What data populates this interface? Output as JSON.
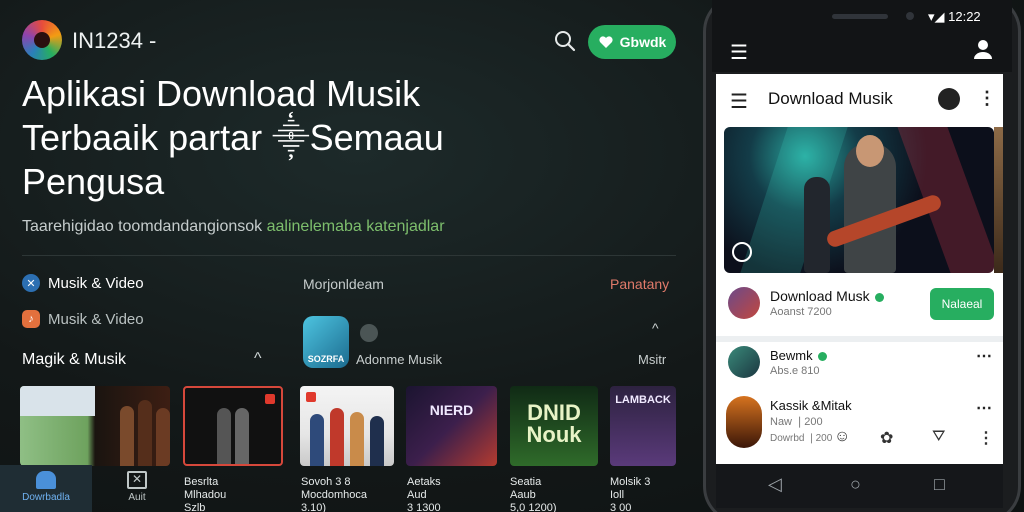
{
  "header": {
    "brand": "IN1234 -",
    "download_label": "Gbwdk"
  },
  "hero": {
    "title": "Aplikasi Download Musik Terbaaik partar ⸎Semaau Pengusa",
    "subtitle_a": "Taarehigidao toomdandangionsok ",
    "subtitle_b": "aalinelemaba katenjadlar"
  },
  "sidebar": {
    "items": [
      {
        "label": "Musik & Video",
        "icon": "globe-icon"
      },
      {
        "label": "Musik & Video",
        "icon": "app-icon"
      }
    ],
    "section_title": "Magik & Musik",
    "section_chevron": "^"
  },
  "middle": {
    "heading": "Morjonldeam",
    "right_label": "Panatany",
    "album_badge": "SOZRFA",
    "tag_label": "Adonme Musik",
    "side_label": "Msitr",
    "chevron": "^"
  },
  "thumbnails": [
    {
      "name": "field-band",
      "text": ""
    },
    {
      "name": "dark-duo",
      "text": ""
    },
    {
      "name": "band-portrait",
      "text": ""
    },
    {
      "name": "neon-guitar",
      "text": "NIERD"
    },
    {
      "name": "dnid-nouk",
      "text": "DNID\nNouk"
    },
    {
      "name": "purple-band",
      "text": "LAMBACK"
    }
  ],
  "captions": [
    {
      "line1": "Besrlta",
      "line2": "Mlhadou",
      "line3": "Szlb"
    },
    {
      "line1": "Sovoh 3 8",
      "line2": "Mocdomhoca",
      "line3": "3.10)"
    },
    {
      "line1": "Aetaks",
      "line2": "Aud",
      "line3": "3 1300"
    },
    {
      "line1": "Seatia",
      "line2": "Aaub",
      "line3": "5,0 1200)"
    },
    {
      "line1": "Molsik 3",
      "line2": "Ioll",
      "line3": "3 00"
    }
  ],
  "bottom_nav": [
    {
      "label": "Dowrbadla",
      "icon": "home-icon",
      "active": true
    },
    {
      "label": "Auit",
      "icon": "library-icon",
      "active": false
    }
  ],
  "phone": {
    "status": "▾◢ 12:22",
    "screen_title": "Download Musik",
    "row1": {
      "title": "Download Musk",
      "sub": "Aoanst 7200",
      "button": "Nalaeal"
    },
    "row2": {
      "title": "Bewmk",
      "sub": "Abs.e 810"
    },
    "row3": {
      "title": "Kassik &Mitak",
      "sub": "Naw ❘200",
      "meta": "Dowrbd ❘200"
    }
  },
  "colors": {
    "accent_green": "#27ae60",
    "accent_red": "#e07a6a",
    "background": "#131818"
  }
}
